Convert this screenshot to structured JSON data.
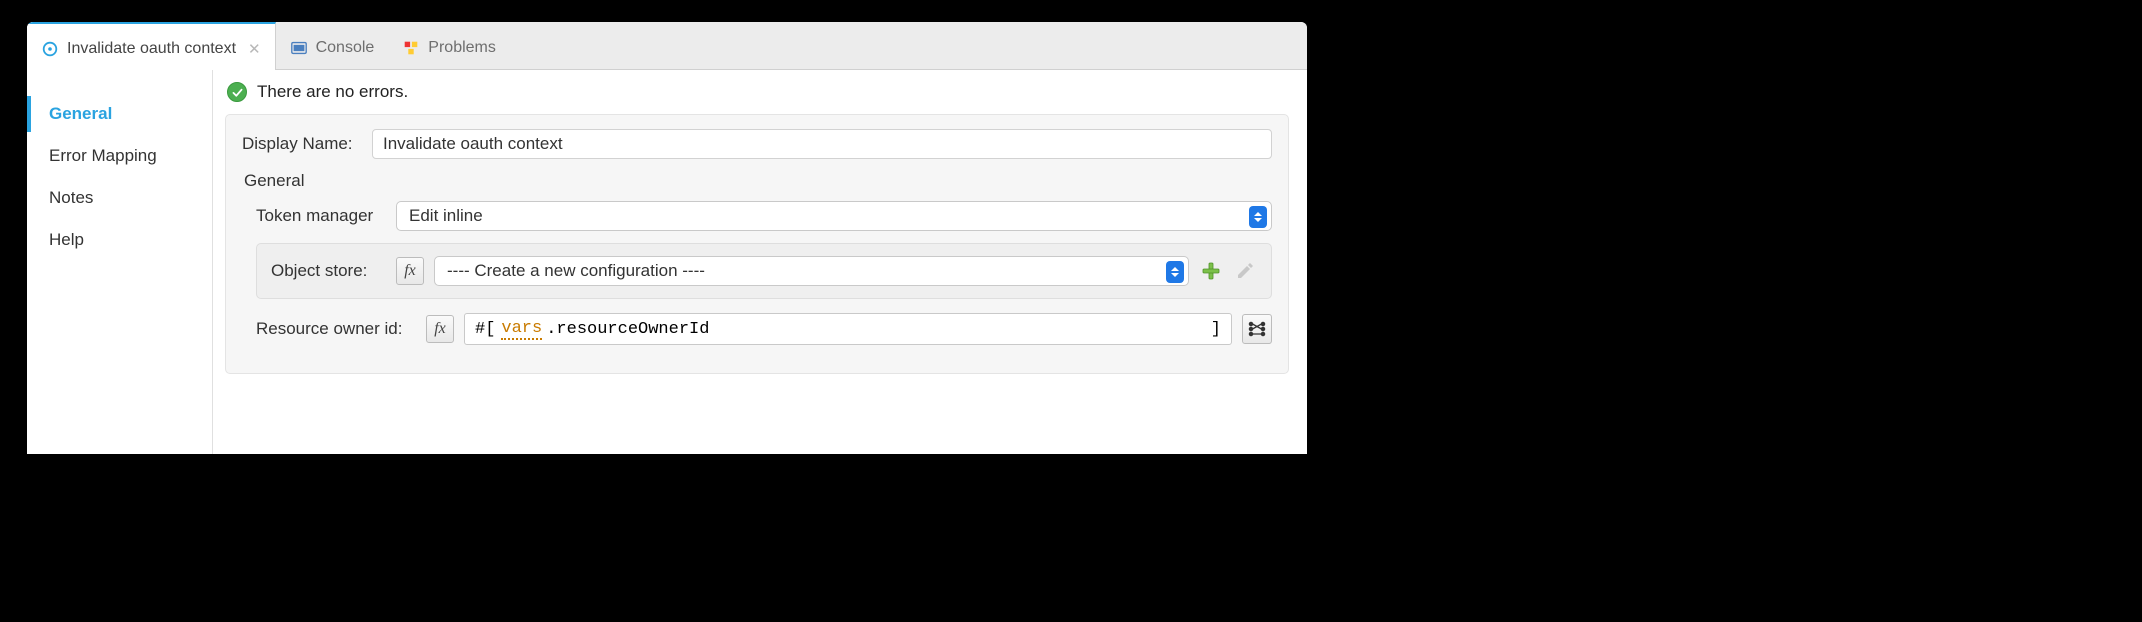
{
  "tabs": [
    {
      "label": "Invalidate oauth context",
      "active": true,
      "closable": true,
      "icon": "component-icon"
    },
    {
      "label": "Console",
      "active": false,
      "icon": "console-icon"
    },
    {
      "label": "Problems",
      "active": false,
      "icon": "problems-icon"
    }
  ],
  "sidebar": {
    "items": [
      {
        "label": "General",
        "active": true
      },
      {
        "label": "Error Mapping",
        "active": false
      },
      {
        "label": "Notes",
        "active": false
      },
      {
        "label": "Help",
        "active": false
      }
    ]
  },
  "status": {
    "message": "There are no errors."
  },
  "form": {
    "displayNameLabel": "Display Name:",
    "displayNameValue": "Invalidate oauth context",
    "generalGroupTitle": "General",
    "tokenManagerLabel": "Token manager",
    "tokenManagerValue": "Edit inline",
    "objectStoreLabel": "Object store:",
    "objectStoreValue": "---- Create a new configuration ----",
    "resourceOwnerIdLabel": "Resource owner id:",
    "resourceOwnerIdExpr": {
      "prefix": "#[",
      "vars": "vars",
      "rest": ".resourceOwnerId",
      "suffix": "]"
    }
  }
}
